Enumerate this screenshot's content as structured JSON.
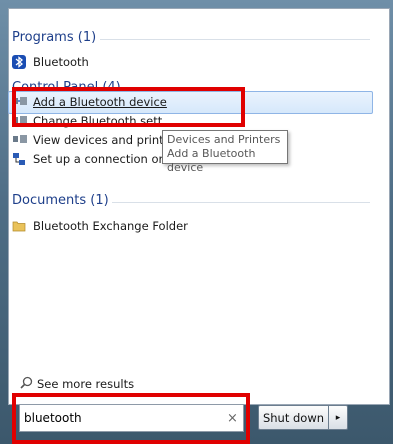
{
  "programs": {
    "header": "Programs (1)",
    "items": [
      {
        "label": "Bluetooth",
        "icon": "bluetooth-icon"
      }
    ]
  },
  "control_panel": {
    "header": "Control Panel (4)",
    "items": [
      {
        "label": "Add a Bluetooth device",
        "icon": "bluetooth-device-icon"
      },
      {
        "label": "Change Bluetooth sett",
        "icon": "bluetooth-device-icon"
      },
      {
        "label": "View devices and print",
        "icon": "bluetooth-device-icon"
      },
      {
        "label": "Set up a connection or network",
        "icon": "network-icon"
      }
    ]
  },
  "tooltip": {
    "line1": "Devices and Printers",
    "line2": "Add a Bluetooth device"
  },
  "documents": {
    "header": "Documents (1)",
    "items": [
      {
        "label": "Bluetooth Exchange Folder",
        "icon": "folder-icon"
      }
    ]
  },
  "see_more": "See more results",
  "search": {
    "value": "bluetooth",
    "clear": "×"
  },
  "shutdown": {
    "label": "Shut down",
    "arrow": "▸"
  },
  "colors": {
    "header": "#1e3f8a",
    "highlight_border": "#e00000",
    "selected_bg": "#d6e8fb"
  }
}
